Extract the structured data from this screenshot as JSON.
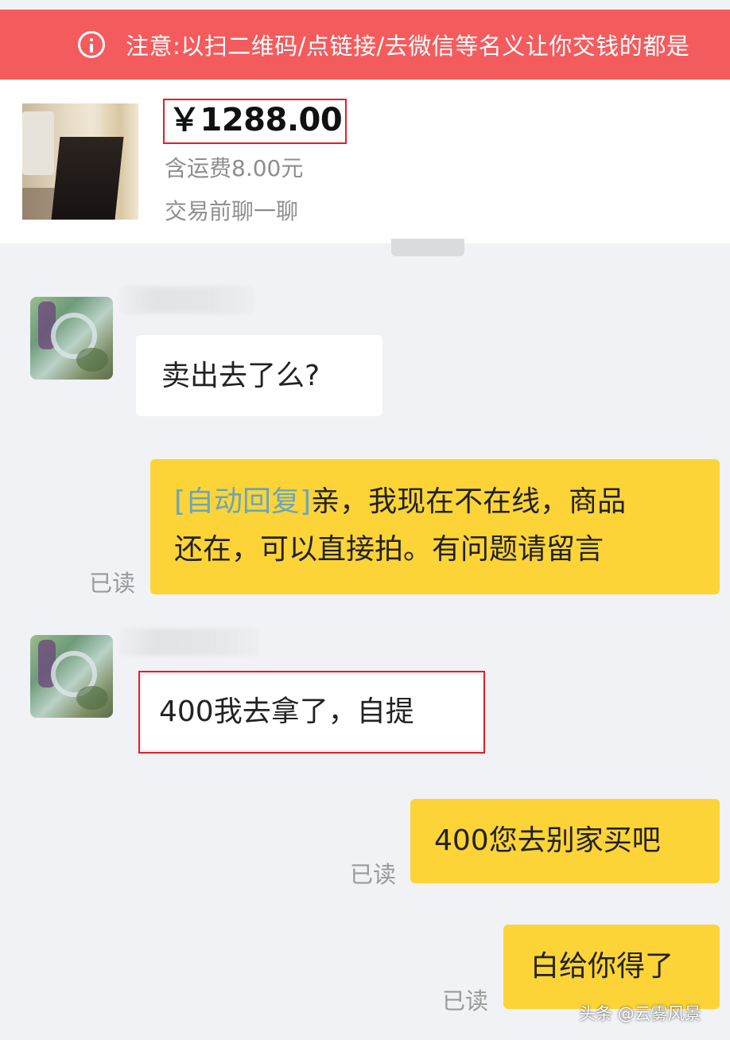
{
  "warning": {
    "text": "注意:以扫二维码/点链接/去微信等名义让你交钱的都是"
  },
  "product": {
    "price": "￥1288.00",
    "shipping": "含运费8.00元",
    "chat_hint": "交易前聊一聊"
  },
  "messages": [
    {
      "sender": "buyer",
      "text": "卖出去了么?"
    },
    {
      "sender": "seller",
      "auto_tag": "[自动回复]",
      "line1": "亲，我现在不在线，商品",
      "line2": "还在，可以直接拍。有问题请留言",
      "status": "已读"
    },
    {
      "sender": "buyer",
      "text": "400我去拿了，自提"
    },
    {
      "sender": "seller",
      "text": "400您去别家买吧",
      "status": "已读"
    },
    {
      "sender": "seller",
      "text": "白给你得了",
      "status": "已读"
    }
  ],
  "watermark": "头条 @云雾风景",
  "colors": {
    "warning_bg": "#f45b5d",
    "seller_bubble": "#fcd437",
    "buyer_bubble": "#ffffff",
    "auto_reply_tag": "#6aa6bd",
    "highlight": "#e21f26"
  },
  "icons": {
    "warning": "info-circle-icon"
  }
}
